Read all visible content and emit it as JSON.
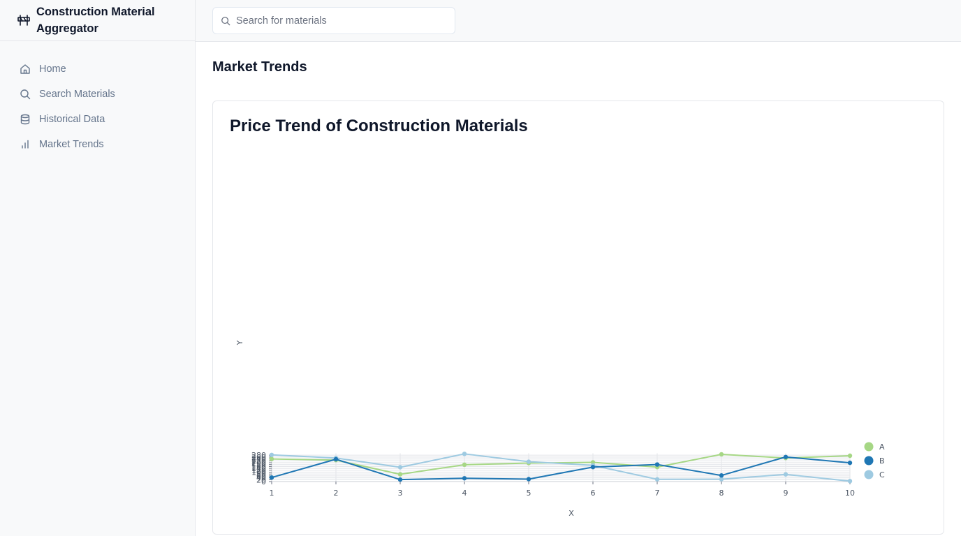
{
  "app": {
    "title": "Construction Material Aggregator"
  },
  "sidebar": {
    "items": [
      {
        "label": "Home",
        "icon": "home-icon"
      },
      {
        "label": "Search Materials",
        "icon": "search-icon"
      },
      {
        "label": "Historical Data",
        "icon": "database-icon"
      },
      {
        "label": "Market Trends",
        "icon": "bar-chart-icon"
      }
    ]
  },
  "search": {
    "placeholder": "Search for materials",
    "value": ""
  },
  "page": {
    "title": "Market Trends"
  },
  "card": {
    "title": "Price Trend of Construction Materials"
  },
  "colors": {
    "A": "#a6d785",
    "B": "#1f77b4",
    "C": "#9ecae1"
  },
  "chart_data": {
    "type": "line",
    "x": [
      1,
      2,
      3,
      4,
      5,
      6,
      7,
      8,
      9,
      10
    ],
    "series": [
      {
        "name": "A",
        "values": [
          240,
          228,
          77,
          179,
          196,
          204,
          154,
          289,
          250,
          274
        ]
      },
      {
        "name": "B",
        "values": [
          43,
          237,
          21,
          35,
          26,
          154,
          181,
          65,
          261,
          199
        ]
      },
      {
        "name": "C",
        "values": [
          283,
          250,
          152,
          294,
          211,
          172,
          24,
          25,
          76,
          5
        ]
      }
    ],
    "xlabel": "X",
    "ylabel": "Y",
    "xlim": [
      1,
      10
    ],
    "ylim": [
      0,
      280
    ],
    "yticks": [
      0,
      20,
      40,
      60,
      80,
      100,
      120,
      140,
      160,
      180,
      200,
      220,
      240,
      260,
      280
    ],
    "grid": true,
    "legend": "right"
  }
}
